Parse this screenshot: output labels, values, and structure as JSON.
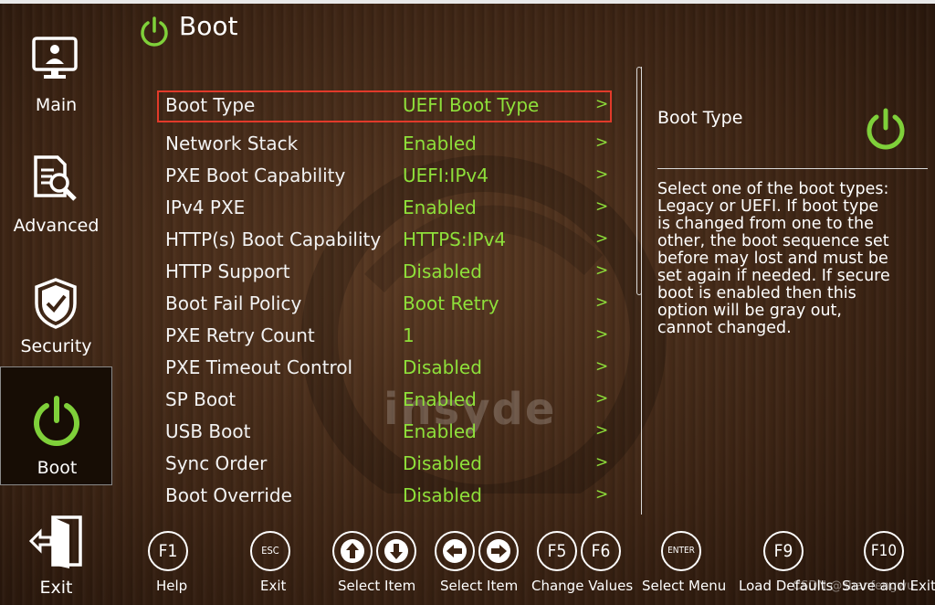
{
  "header": {
    "title": "Boot"
  },
  "sidebar": {
    "items": [
      {
        "label": "Main",
        "icon": "monitor-user-icon",
        "active": false
      },
      {
        "label": "Advanced",
        "icon": "document-search-icon",
        "active": false
      },
      {
        "label": "Security",
        "icon": "shield-check-icon",
        "active": false
      },
      {
        "label": "Boot",
        "icon": "power-icon",
        "active": true
      },
      {
        "label": "Exit",
        "icon": "exit-door-icon",
        "active": false
      }
    ]
  },
  "settings": [
    {
      "label": "Boot Type",
      "value": "UEFI Boot Type",
      "arrow": ">"
    },
    {
      "label": "Network Stack",
      "value": "Enabled",
      "arrow": ">"
    },
    {
      "label": "PXE Boot Capability",
      "value": "UEFI:IPv4",
      "arrow": ">"
    },
    {
      "label": "IPv4 PXE",
      "value": "Enabled",
      "arrow": ">"
    },
    {
      "label": "HTTP(s) Boot Capability",
      "value": "HTTPS:IPv4",
      "arrow": ">"
    },
    {
      "label": "HTTP Support",
      "value": "Disabled",
      "arrow": ">"
    },
    {
      "label": "Boot Fail Policy",
      "value": "Boot Retry",
      "arrow": ">"
    },
    {
      "label": "PXE Retry Count",
      "value": "1",
      "arrow": ">"
    },
    {
      "label": "PXE Timeout Control",
      "value": "Disabled",
      "arrow": ">"
    },
    {
      "label": "SP Boot",
      "value": "Enabled",
      "arrow": ">"
    },
    {
      "label": "USB Boot",
      "value": "Enabled",
      "arrow": ">"
    },
    {
      "label": "Sync Order",
      "value": "Disabled",
      "arrow": ">"
    },
    {
      "label": "Boot Override",
      "value": "Disabled",
      "arrow": ">"
    }
  ],
  "help": {
    "title": "Boot Type",
    "lines": [
      "Select one of the boot types:",
      "Legacy or UEFI. If boot type",
      "is changed from one to the",
      "other, the boot sequence set",
      "before may lost and must be",
      "set again if needed. If secure",
      "boot is enabled then this",
      "option will be gray out,",
      "cannot changed."
    ]
  },
  "keys": [
    {
      "keys": [
        "F1"
      ],
      "label": "Help"
    },
    {
      "keys": [
        "ESC"
      ],
      "label": "Exit"
    },
    {
      "keys": [
        "up-arrow-icon",
        "down-arrow-icon"
      ],
      "label": "Select Item"
    },
    {
      "keys": [
        "left-arrow-icon",
        "right-arrow-icon"
      ],
      "label": "Select Item"
    },
    {
      "keys": [
        "F5",
        "F6"
      ],
      "label": "Change Values"
    },
    {
      "keys": [
        "ENTER"
      ],
      "label": "Select Menu"
    },
    {
      "keys": [
        "F9"
      ],
      "label": "Load Defaults"
    },
    {
      "keys": [
        "F10"
      ],
      "label": "Save and Exit"
    }
  ],
  "background_logo": "insyde",
  "watermark": "CSDN @shanfengwu",
  "colors": {
    "value_green": "#8ee03a",
    "selection_red": "#e23a2a",
    "accent_green": "#7fd03a"
  }
}
